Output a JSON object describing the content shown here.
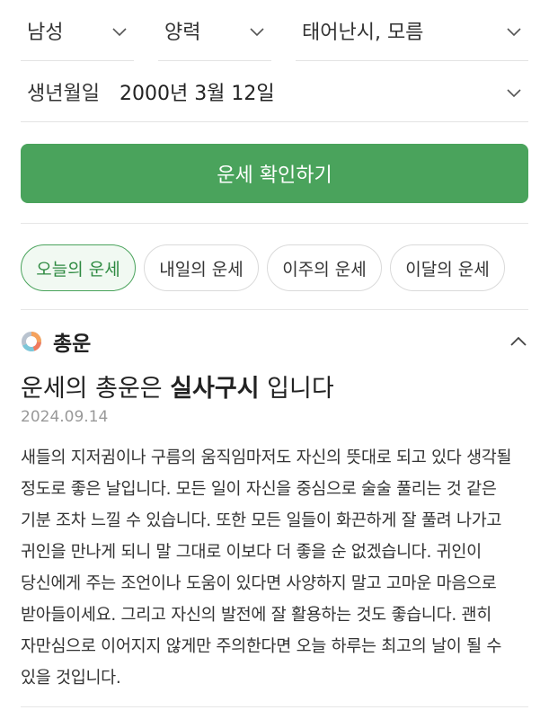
{
  "selectors": {
    "gender": "남성",
    "calendar": "양력",
    "birth_time": "태어난시, 모름"
  },
  "birthdate": {
    "label": "생년월일",
    "value": "2000년 3월 12일"
  },
  "cta_label": "운세 확인하기",
  "tabs": [
    {
      "label": "오늘의 운세",
      "active": true
    },
    {
      "label": "내일의 운세",
      "active": false
    },
    {
      "label": "이주의 운세",
      "active": false
    },
    {
      "label": "이달의 운세",
      "active": false
    }
  ],
  "section": {
    "title": "총운",
    "icon": "donut-chart-icon",
    "headline_prefix": "운세의 총운은 ",
    "headline_emphasis": "실사구시",
    "headline_suffix": " 입니다",
    "date": "2024.09.14",
    "body": "새들의 지저귐이나 구름의 움직임마저도 자신의 뜻대로 되고 있다 생각될 정도로 좋은 날입니다. 모든 일이 자신을 중심으로 술술 풀리는 것 같은 기분 조차 느낄 수 있습니다. 또한 모든 일들이 화끈하게 잘 풀려 나가고 귀인을 만나게 되니 말 그대로 이보다 더 좋을 순 없겠습니다. 귀인이 당신에게 주는 조언이나 도움이 있다면 사양하지 말고 고마운 마음으로 받아들이세요. 그리고 자신의 발전에 잘 활용하는 것도 좋습니다. 괜히 자만심으로 이어지지 않게만 주의한다면 오늘 하루는 최고의 날이 될 수 있을 것입니다."
  },
  "colors": {
    "accent": "#4aa35c",
    "donut": [
      "#f5a25d",
      "#f07b5e",
      "#7cc7d9",
      "#b9c3cf"
    ]
  }
}
